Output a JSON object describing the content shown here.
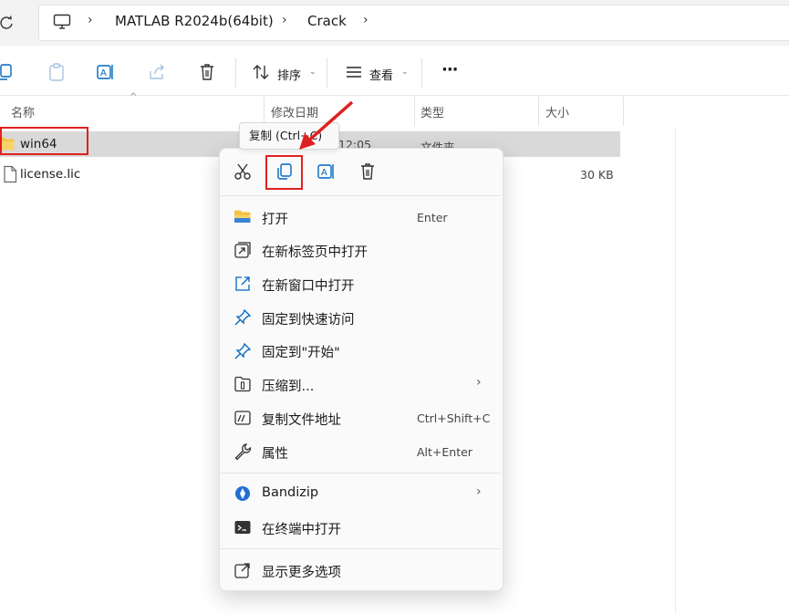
{
  "address": {
    "crumbs": [
      "MATLAB R2024b(64bit)",
      "Crack"
    ]
  },
  "toolbar": {
    "sort_label": "排序",
    "view_label": "查看",
    "more_label": "···"
  },
  "columns": {
    "name": "名称",
    "modified": "修改日期",
    "type": "类型",
    "size": "大小"
  },
  "files": [
    {
      "name": "win64",
      "modified": "12:05",
      "type": "文件夹",
      "size": ""
    },
    {
      "name": "license.lic",
      "modified": "",
      "type": "",
      "size": "30 KB"
    }
  ],
  "tooltip": {
    "text": "复制 (Ctrl+C)"
  },
  "menu": {
    "items": [
      {
        "label": "打开",
        "shortcut": "Enter"
      },
      {
        "label": "在新标签页中打开",
        "shortcut": ""
      },
      {
        "label": "在新窗口中打开",
        "shortcut": ""
      },
      {
        "label": "固定到快速访问",
        "shortcut": ""
      },
      {
        "label": "固定到\"开始\"",
        "shortcut": ""
      },
      {
        "label": "压缩到...",
        "shortcut": ""
      },
      {
        "label": "复制文件地址",
        "shortcut": "Ctrl+Shift+C"
      },
      {
        "label": "属性",
        "shortcut": "Alt+Enter"
      },
      {
        "label": "Bandizip",
        "shortcut": ""
      },
      {
        "label": "在终端中打开",
        "shortcut": ""
      },
      {
        "label": "显示更多选项",
        "shortcut": ""
      }
    ]
  },
  "colors": {
    "accent": "#0067c0",
    "highlight_red": "#e02020",
    "folder_yellow": "#f4c542"
  }
}
